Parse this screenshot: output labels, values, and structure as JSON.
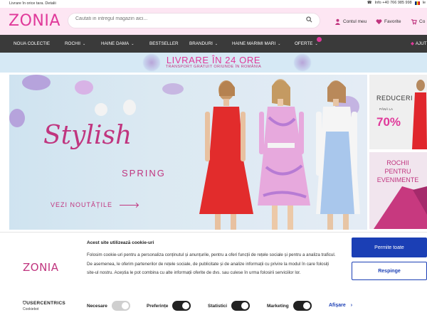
{
  "topstrip": {
    "left_text": "Livrare în orice tara. Detalii",
    "phone": "Info +40 766 985 998",
    "lang": "le"
  },
  "header": {
    "logo": "ZONIA",
    "search_placeholder": "Cautati in intregul magazin aici...",
    "account_label": "Contul meu",
    "favorites_label": "Favorite",
    "cart_label": "Co",
    "icons": [
      "search-icon",
      "user-icon",
      "heart-icon",
      "cart-icon"
    ]
  },
  "nav": {
    "items": [
      {
        "label": "NOUA COLECTIE",
        "chevron": ""
      },
      {
        "label": "ROCHII",
        "chevron": "⌄"
      },
      {
        "label": "HAINE DAMA",
        "chevron": "⌄"
      },
      {
        "label": "BESTSELLER",
        "chevron": ""
      },
      {
        "label": "BRANDURI",
        "chevron": "⌄"
      },
      {
        "label": "HAINE MARIMI MARI",
        "chevron": "⌄"
      },
      {
        "label": "OFERTE",
        "chevron": "⌄"
      },
      {
        "label": "AJUT",
        "chevron": ""
      }
    ]
  },
  "promo": {
    "title": "LIVRARE ÎN 24 ORE",
    "subtitle": "TRANSPORT GRATUIT ORIUNDE ÎN ROMÂNIA"
  },
  "hero": {
    "title": "Stylish",
    "subtitle": "SPRING",
    "cta": "VEZI NOUTĂȚILE"
  },
  "side_tiles": {
    "tile1_title": "REDUCERI",
    "tile1_sub": "PÂNĂ LA",
    "tile1_percent": "70%",
    "tile2_title": "ROCHII PENTRU EVENIMENTE"
  },
  "cookie": {
    "logo": "ZONIA",
    "title": "Acest site utilizează cookie-uri",
    "text": "Folosim cookie-uri pentru a personaliza conținutul și anunțurile, pentru a oferi funcții de rețele sociale și pentru a analiza traficul. De asemenea, le oferim partenerilor de rețele sociale, de publicitate și de analize informații cu privire la modul în care folosiți site-ul nostru. Aceștia le pot combina cu alte informații oferite de dvs. sau culese în urma folosirii serviciilor lor.",
    "allow_all": "Permite toate",
    "reject": "Respinge",
    "usercentrics": "USERCENTRICS",
    "cookiebot": "Cookiebot",
    "toggles": [
      {
        "label": "Necesare",
        "state": "disabled"
      },
      {
        "label": "Preferințe",
        "state": "off"
      },
      {
        "label": "Statistici",
        "state": "off"
      },
      {
        "label": "Marketing",
        "state": "off"
      }
    ],
    "details": "Afișare"
  },
  "colors": {
    "brand_pink": "#e0399a",
    "nav_dark": "#3a3a3a",
    "cookie_blue": "#1b3fb5"
  }
}
